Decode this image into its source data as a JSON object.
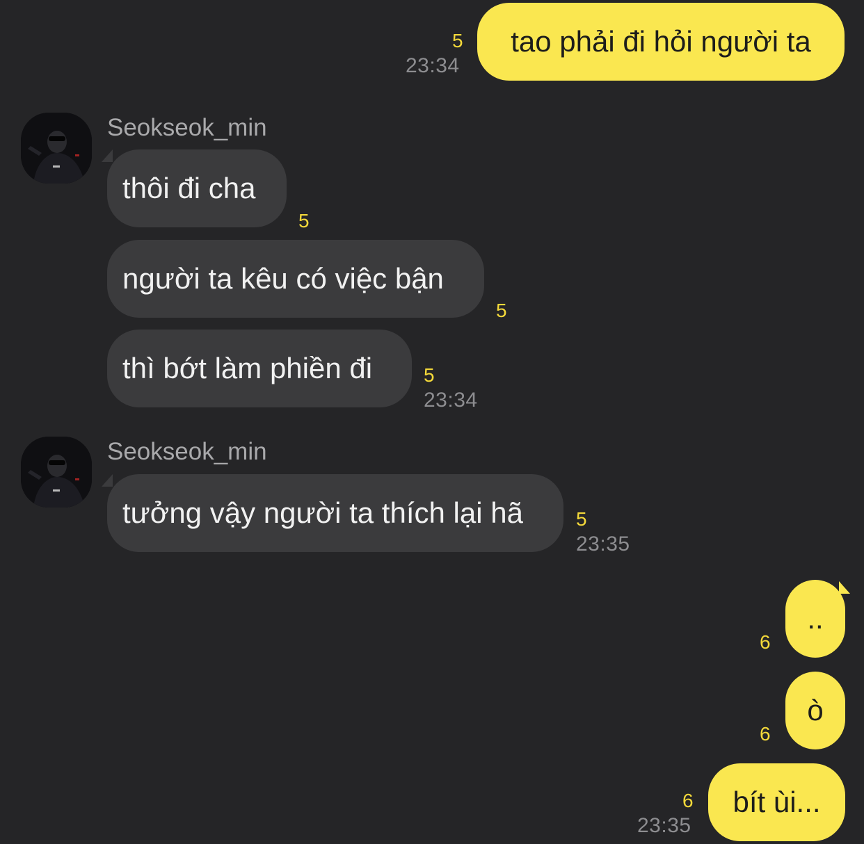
{
  "messages": {
    "m1": {
      "text": "tao phải đi hỏi người ta",
      "unread": "5",
      "time": "23:34"
    },
    "g1": {
      "sender": "Seokseok_min",
      "m1": {
        "text": "thôi đi cha",
        "unread": "5"
      },
      "m2": {
        "text": "người ta kêu có việc bận",
        "unread": "5"
      },
      "m3": {
        "text": "thì bớt làm phiền đi",
        "unread": "5",
        "time": "23:34"
      }
    },
    "g2": {
      "sender": "Seokseok_min",
      "m1": {
        "text": "tưởng vậy người ta thích lại hã",
        "unread": "5",
        "time": "23:35"
      }
    },
    "m5": {
      "text": "..",
      "unread": "6"
    },
    "m6": {
      "text": "ò",
      "unread": "6"
    },
    "m7": {
      "text": "bít ùi...",
      "unread": "6",
      "time": "23:35"
    }
  },
  "avatar_icon": "user-photo-avatar",
  "colors": {
    "background": "#252527",
    "outgoing_bubble": "#fae750",
    "incoming_bubble": "#3b3b3d",
    "unread_count": "#f4d93a",
    "timestamp": "#8d8d90"
  }
}
